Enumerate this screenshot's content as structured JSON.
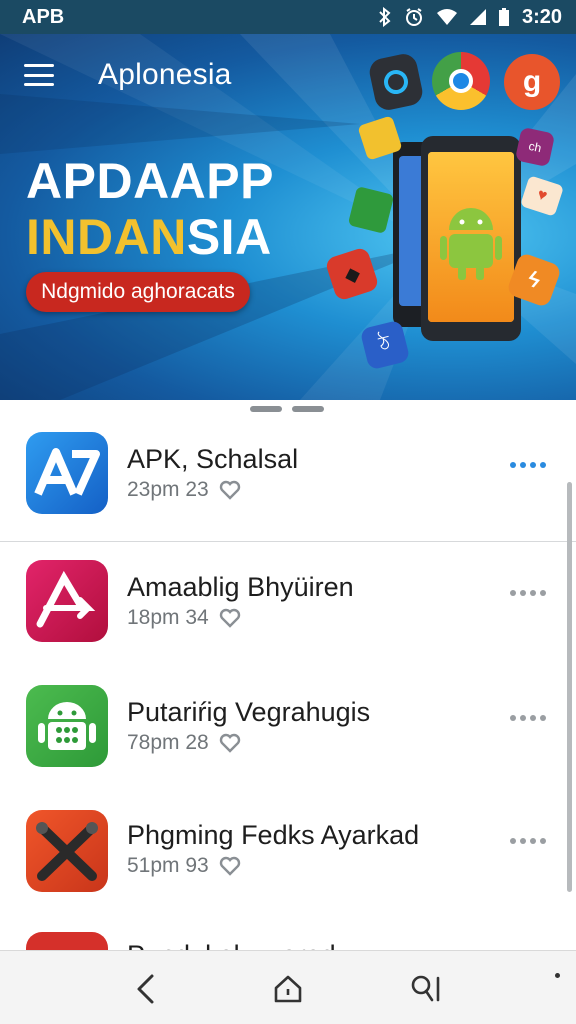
{
  "status_bar": {
    "left_text": "APB",
    "time": "3:20"
  },
  "hero": {
    "app_title": "Aplonesia",
    "headline_line1": "APDAAPP",
    "headline_line2_a": "INDAN",
    "headline_line2_b": "SIA",
    "pill_label": "Ndgmido aghoracats"
  },
  "apps": [
    {
      "name": "APK, Schalsal",
      "meta": "23pm 23",
      "icon": "ap-logo-icon",
      "color": "#1a73d8"
    },
    {
      "name": "Amaablig Bhyüiren",
      "meta": "18pm 34",
      "icon": "arrow-logo-icon",
      "color": "#c9134e"
    },
    {
      "name": "Putariŕig Vegrahugis",
      "meta": "78pm 28",
      "icon": "android-icon",
      "color": "#3aa844"
    },
    {
      "name": "Phgming Fedks Ayarkad",
      "meta": "51pm 93",
      "icon": "tools-icon",
      "color": "#d6401e"
    },
    {
      "name": "Pundukel...wored",
      "meta": "",
      "icon": "star-logo-icon",
      "color": "#d5302a"
    }
  ],
  "nav": {
    "back": "back-icon",
    "home": "home-icon",
    "search": "search-icon"
  }
}
